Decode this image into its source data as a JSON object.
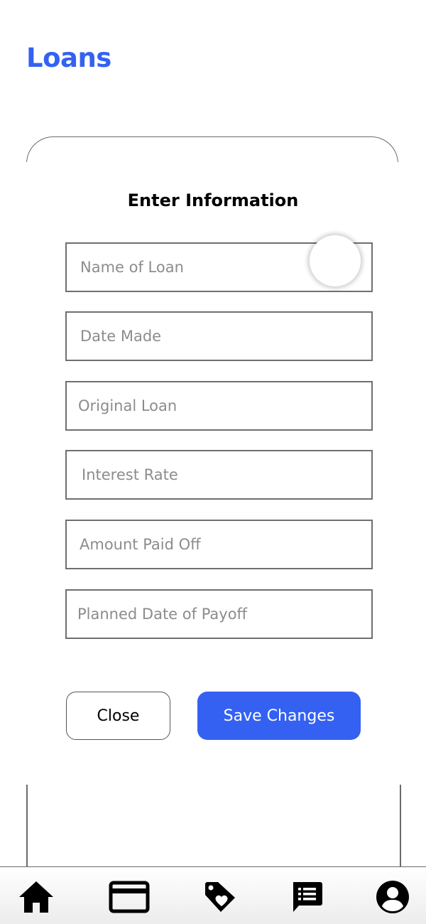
{
  "header": {
    "title": "Loans"
  },
  "form": {
    "heading": "Enter Information",
    "fields": [
      {
        "placeholder": "Name of Loan",
        "value": ""
      },
      {
        "placeholder": "Date Made",
        "value": ""
      },
      {
        "placeholder": "Original Loan",
        "value": ""
      },
      {
        "placeholder": "Interest Rate",
        "value": ""
      },
      {
        "placeholder": "Amount Paid Off",
        "value": ""
      },
      {
        "placeholder": "Planned Date of Payoff",
        "value": ""
      }
    ],
    "close_label": "Close",
    "save_label": "Save Changes"
  },
  "colors": {
    "accent": "#3461f2",
    "border": "#6f6f6f",
    "placeholder": "#8c8c8c"
  },
  "bottom_nav": {
    "items": [
      {
        "icon": "home-icon"
      },
      {
        "icon": "credit-card-icon"
      },
      {
        "icon": "tag-heart-icon"
      },
      {
        "icon": "chat-list-icon"
      },
      {
        "icon": "account-icon"
      }
    ]
  }
}
